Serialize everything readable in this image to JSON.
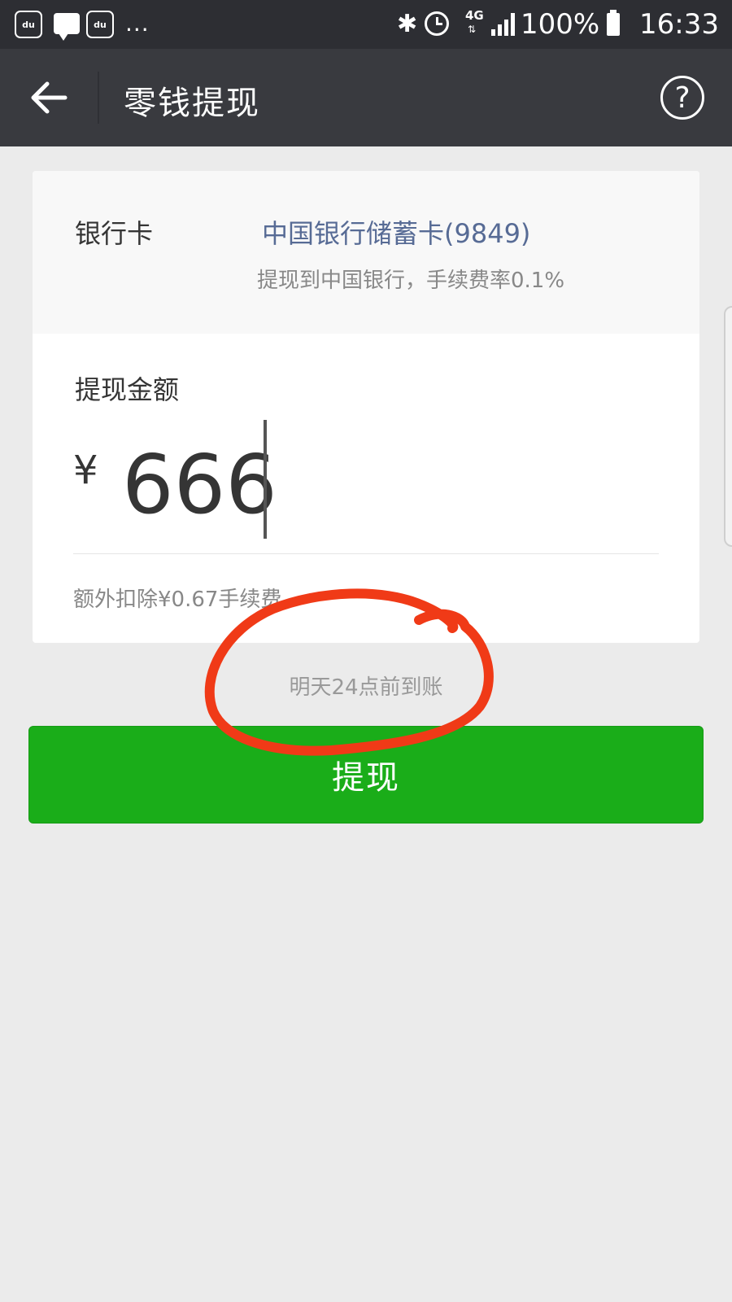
{
  "status_bar": {
    "notification_icons": [
      "baidu-icon",
      "chat-icon",
      "baidu-icon"
    ],
    "baidu_icon_text": "du",
    "more": "...",
    "network": "4G",
    "battery": "100%",
    "time": "16:33"
  },
  "nav": {
    "title": "零钱提现",
    "help": "?"
  },
  "bank": {
    "label": "银行卡",
    "name": "中国银行储蓄卡(9849)",
    "description": "提现到中国银行，手续费率0.1%"
  },
  "amount": {
    "label": "提现金额",
    "currency": "¥",
    "value": "666",
    "fee_note": "额外扣除¥0.67手续费"
  },
  "arrival_note": "明天24点前到账",
  "withdraw_button": "提现",
  "colors": {
    "status_bar": "#2d2e33",
    "nav_bar": "#393a3f",
    "link_blue": "#576b95",
    "button_green": "#1aad19",
    "annotation_red": "#f03a17"
  }
}
